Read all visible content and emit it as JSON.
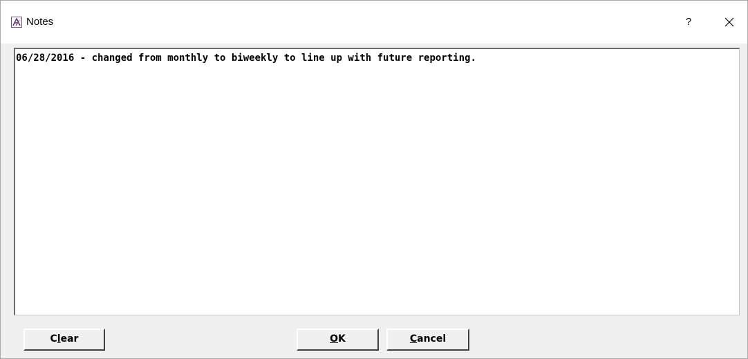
{
  "window": {
    "title": "Notes",
    "help_label": "?"
  },
  "notes": {
    "text": "06/28/2016 - changed from monthly to biweekly to line up with future reporting."
  },
  "buttons": {
    "clear": {
      "before": "C",
      "mnemonic": "l",
      "after": "ear"
    },
    "ok": {
      "before": "",
      "mnemonic": "O",
      "after": "K"
    },
    "cancel": {
      "before": "",
      "mnemonic": "C",
      "after": "ancel"
    }
  },
  "icons": {
    "app": "app-logo-icon",
    "close": "close-icon"
  }
}
